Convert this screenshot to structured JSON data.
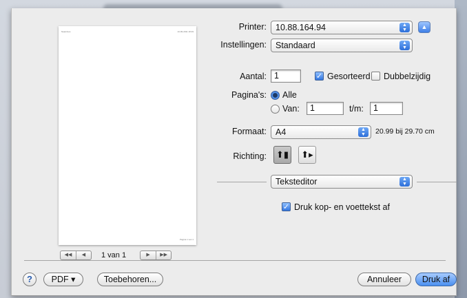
{
  "preview": {
    "header_left": "Naamloos",
    "header_right": "10-09-2011 18:29",
    "footer": "Pagina 1 van 1",
    "page_count": "1 van 1",
    "first_icon": "first-page-icon",
    "prev_icon": "prev-page-icon",
    "next_icon": "next-page-icon",
    "last_icon": "last-page-icon"
  },
  "printer": {
    "label": "Printer:",
    "value": "10.88.164.94"
  },
  "presets": {
    "label": "Instellingen:",
    "value": "Standaard"
  },
  "copies": {
    "label": "Aantal:",
    "value": "1",
    "collated_label": "Gesorteerd",
    "collated": true,
    "two_sided_label": "Dubbelzijdig",
    "two_sided": false
  },
  "pages": {
    "label": "Pagina's:",
    "all_label": "Alle",
    "from_label": "Van:",
    "from_value": "1",
    "to_label": "t/m:",
    "to_value": "1",
    "selected": "all"
  },
  "paper": {
    "label": "Formaat:",
    "value": "A4",
    "size": "20.99 bij 29.70 cm"
  },
  "orientation": {
    "label": "Richting:",
    "portrait_icon": "portrait-icon",
    "landscape_icon": "landscape-icon",
    "selected": "portrait"
  },
  "section": {
    "value": "Teksteditor"
  },
  "header_footer": {
    "label": "Druk kop- en voettekst af",
    "checked": true
  },
  "footer_bar": {
    "help": "?",
    "pdf": "PDF ▾",
    "accessories": "Toebehoren...",
    "cancel": "Annuleer",
    "print": "Druk af"
  },
  "colors": {
    "accent": "#3d7ee6",
    "sheet": "#ececec"
  }
}
